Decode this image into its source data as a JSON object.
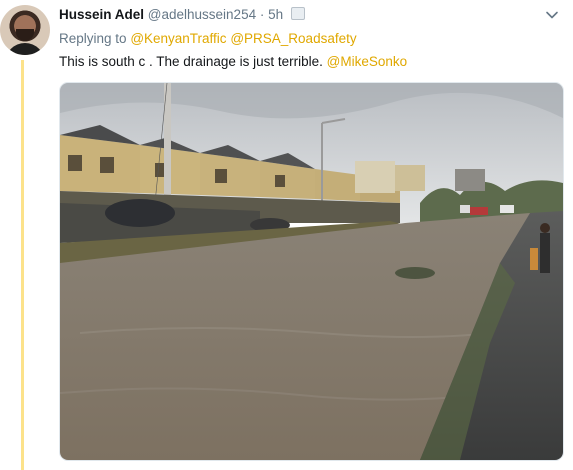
{
  "tweet": {
    "display_name": "Hussein Adel",
    "handle": "@adelhussein254",
    "separator": "·",
    "timestamp": "5h",
    "replying_prefix": "Replying to",
    "reply_mentions": [
      "@KenyanTraffic",
      "@PRSA_Roadsafety"
    ],
    "text": "This is south c . The drainage is just terrible.",
    "text_mention": "@MikeSonko"
  },
  "colors": {
    "accent": "#e0a800",
    "thread_line": "#fce28a",
    "secondary_text": "#657786",
    "primary_text": "#14171a"
  },
  "icons": {
    "more": "chevron-down-icon",
    "verified": "media-badge-icon"
  }
}
